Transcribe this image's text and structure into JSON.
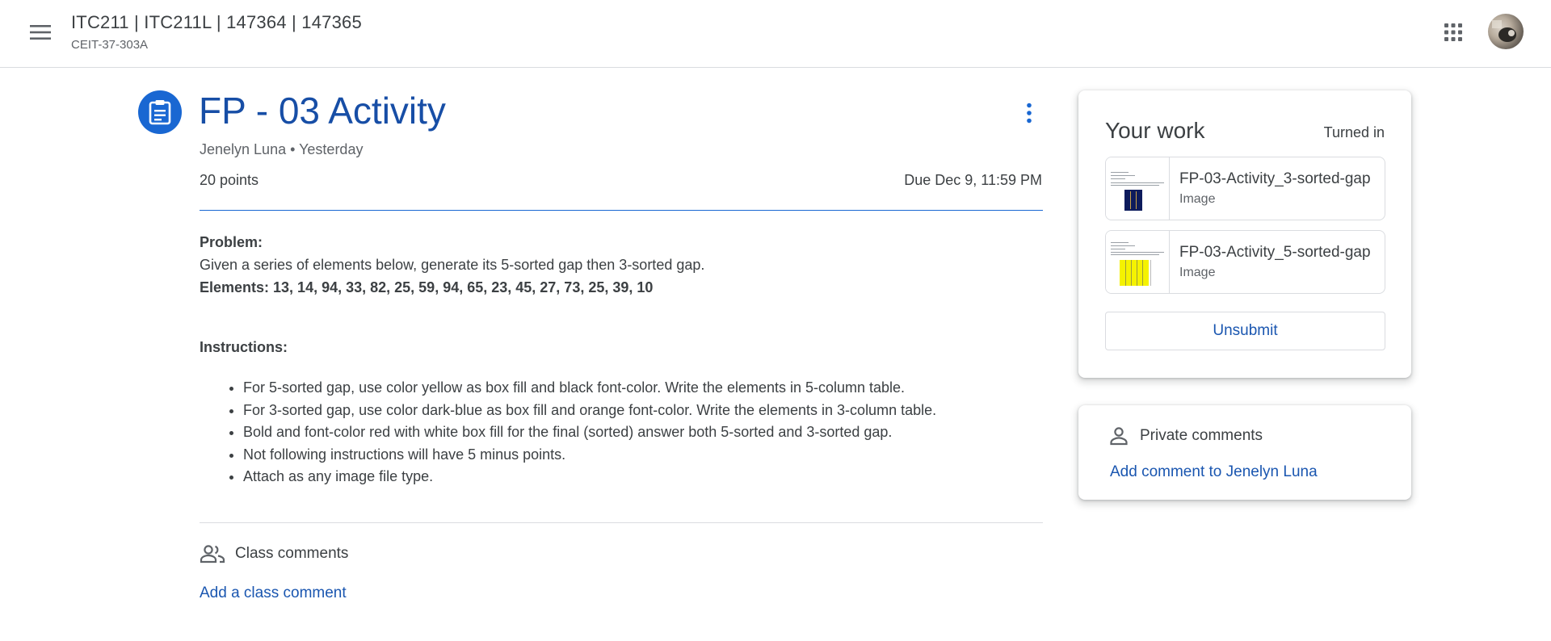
{
  "header": {
    "class_title": "ITC211 | ITC211L | 147364 | 147365",
    "class_section": "CEIT-37-303A",
    "menu_icon": "hamburger-menu-icon",
    "apps_icon": "google-apps-grid-icon"
  },
  "assignment": {
    "title": "FP - 03 Activity",
    "author_line": "Jenelyn Luna • Yesterday",
    "points": "20 points",
    "due": "Due Dec 9, 11:59 PM",
    "problem_label": "Problem:",
    "problem_text": "Given a series of elements below, generate its 5-sorted gap then 3-sorted gap.",
    "elements_line": "Elements: 13, 14, 94, 33, 82, 25, 59, 94, 65, 23, 45, 27, 73, 25, 39, 10",
    "instructions_label": "Instructions:",
    "instructions": [
      "For 5-sorted gap, use color yellow as box fill and black font-color. Write the elements in 5-column table.",
      "For 3-sorted gap, use color dark-blue as box fill and orange font-color. Write the elements in 3-column table.",
      "Bold and font-color red with white box fill for the final (sorted) answer both 5-sorted and 3-sorted gap.",
      "Not following instructions will have 5 minus points.",
      "Attach as any image file type."
    ]
  },
  "class_comments": {
    "label": "Class comments",
    "add_label": "Add a class comment"
  },
  "your_work": {
    "title": "Your work",
    "status": "Turned in",
    "attachments": [
      {
        "name": "FP-03-Activity_3-sorted-gap",
        "type": "Image"
      },
      {
        "name": "FP-03-Activity_5-sorted-gap",
        "type": "Image"
      }
    ],
    "unsubmit_label": "Unsubmit"
  },
  "private_comments": {
    "label": "Private comments",
    "add_label": "Add comment to Jenelyn Luna"
  },
  "colors": {
    "accent_blue": "#1967d2",
    "title_blue": "#174ea6",
    "link_blue": "#1a56b0",
    "text": "#3c4043",
    "muted": "#5f6368"
  }
}
